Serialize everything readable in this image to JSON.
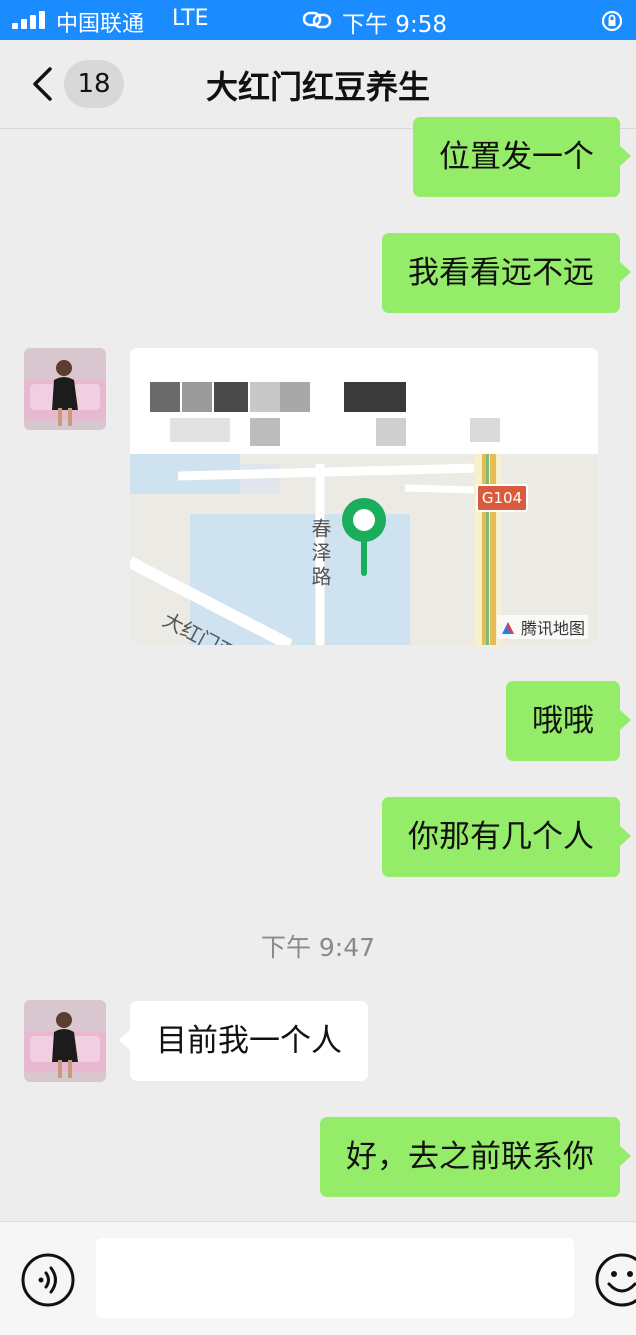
{
  "status_bar": {
    "carrier": "中国联通",
    "network": "LTE",
    "time": "下午 9:58"
  },
  "nav": {
    "unread_count": "18",
    "title": "大红门红豆养生"
  },
  "messages": [
    {
      "side": "out",
      "text": "位置发一个"
    },
    {
      "side": "out",
      "text": "我看看远不远"
    },
    {
      "side": "in",
      "type": "location"
    },
    {
      "side": "out",
      "text": "哦哦"
    },
    {
      "side": "out",
      "text": "你那有几个人"
    },
    {
      "side": "in",
      "text": "目前我一个人"
    },
    {
      "side": "out",
      "text": "好，去之前联系你"
    }
  ],
  "timestamp": "下午 9:47",
  "location_card": {
    "map": {
      "road_vertical": "春泽路",
      "road_diagonal": "大红门西路",
      "highway_badge": "G104",
      "credit": "腾讯地图"
    }
  },
  "input": {
    "placeholder": ""
  },
  "colors": {
    "status_bar": "#1a8cff",
    "outgoing_bubble": "#95ec69",
    "incoming_bubble": "#ffffff",
    "background": "#ededed",
    "map_pin": "#1aad5a"
  },
  "icons": [
    "signal-icon",
    "link-icon",
    "orientation-lock-icon",
    "back-icon",
    "voice-icon",
    "emoji-icon",
    "map-pin-icon",
    "tencent-map-logo-icon"
  ]
}
